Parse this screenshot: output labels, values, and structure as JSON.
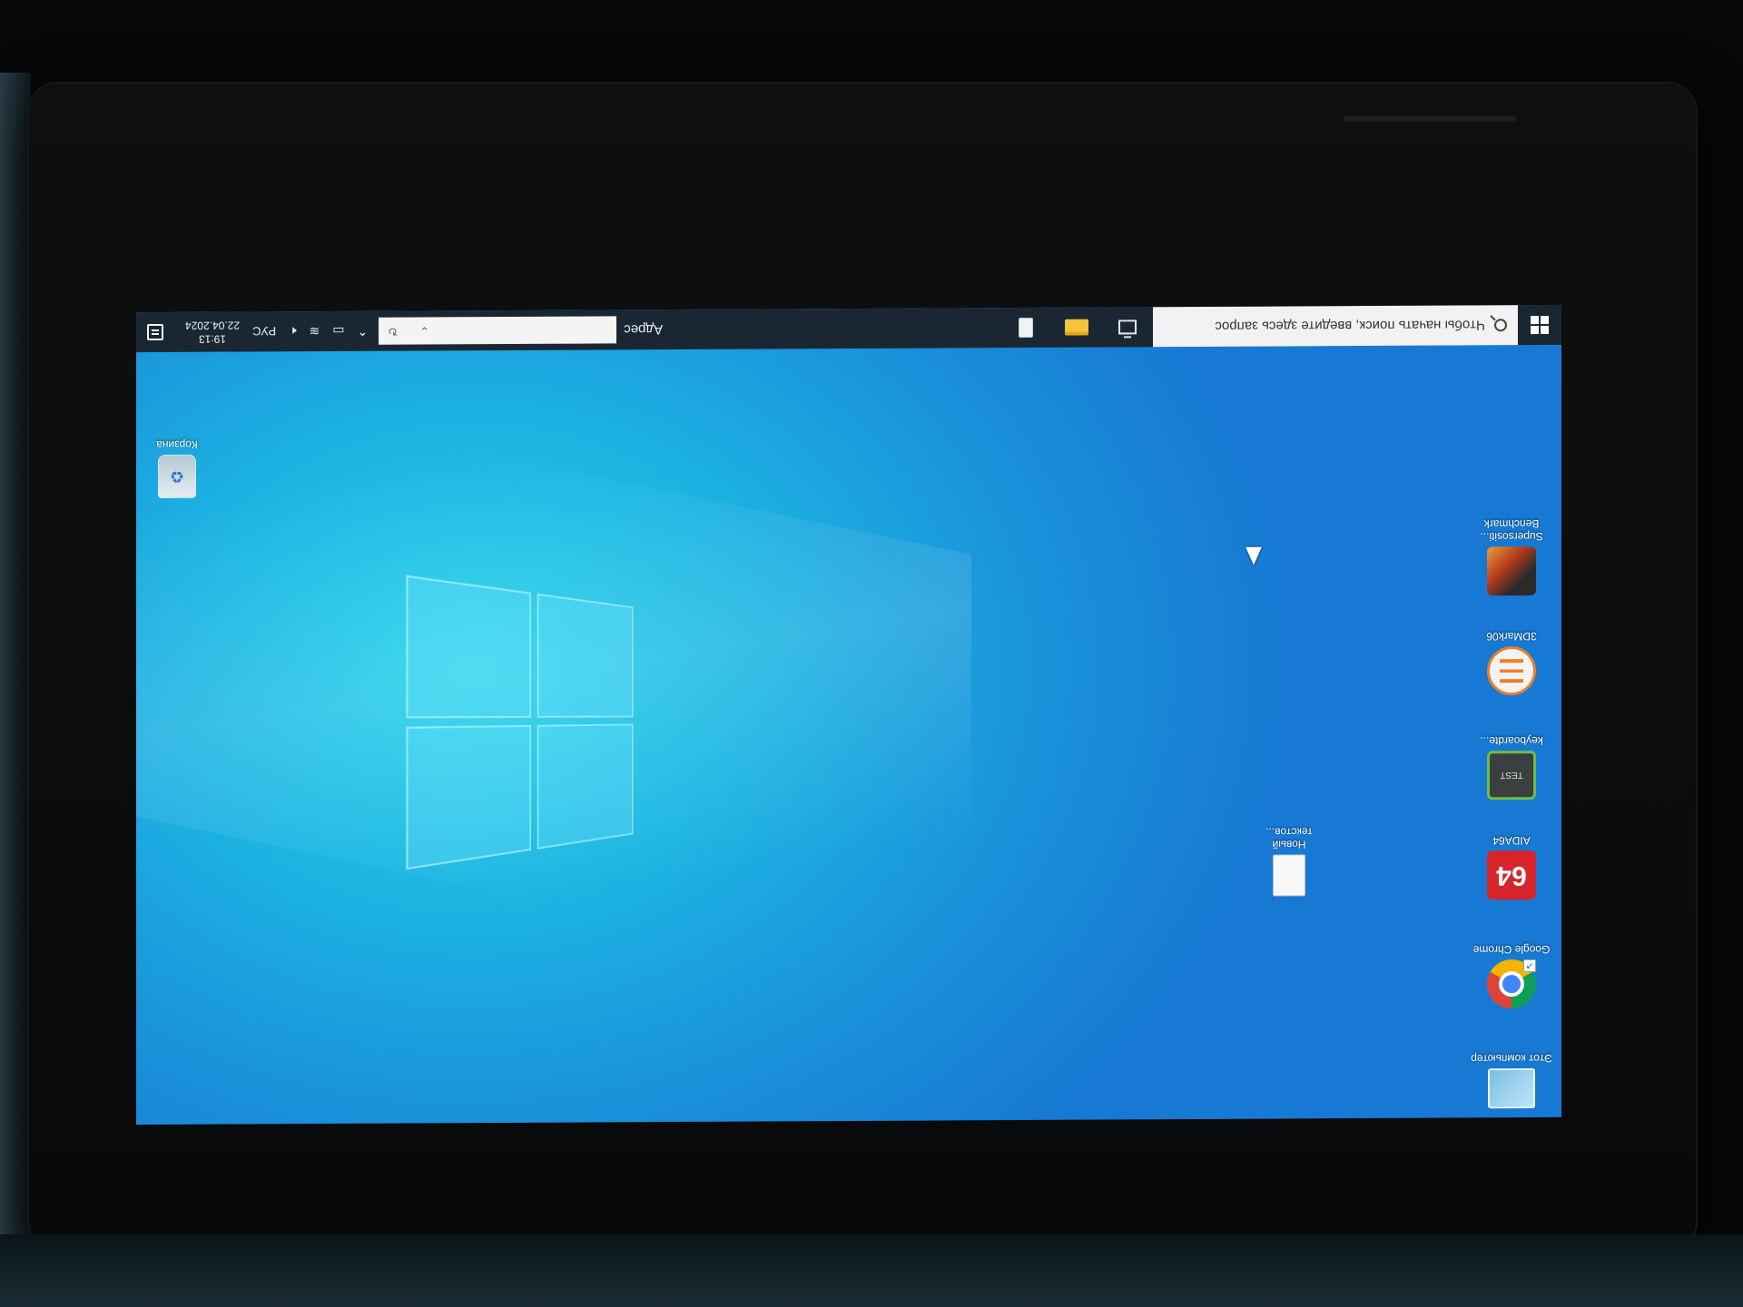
{
  "taskbar": {
    "search_placeholder": "Чтобы начать поиск, введите здесь запрос",
    "address_label": "Адрес",
    "address_value": "",
    "tray": {
      "language": "РУС",
      "time": "19:13",
      "date": "22.04.2024"
    }
  },
  "desktop_icons": {
    "this_pc": "Этот компьютер",
    "chrome": "Google Chrome",
    "aida64": "AIDA64",
    "aida64_glyph": "64",
    "keyboard": "keyboardte...",
    "keyboard_glyph": "TEST",
    "mark3d": "3DMark06",
    "superposition": "Supersositi... Benchmark",
    "new_text": "Новый текстов...",
    "recycle_bin": "Корзина"
  },
  "icons": {
    "start": "windows-start-icon",
    "search": "search-icon",
    "task_view": "task-view-icon",
    "explorer": "folder-icon",
    "notepad": "document-icon",
    "chevron": "chevron-up-icon",
    "network": "network-icon",
    "volume": "speaker-icon",
    "notifications": "notification-icon"
  },
  "colors": {
    "taskbar": "#1a2733",
    "desktop_light": "#28d4ec",
    "desktop_dark": "#1779d4",
    "aida_red": "#d7242a"
  }
}
